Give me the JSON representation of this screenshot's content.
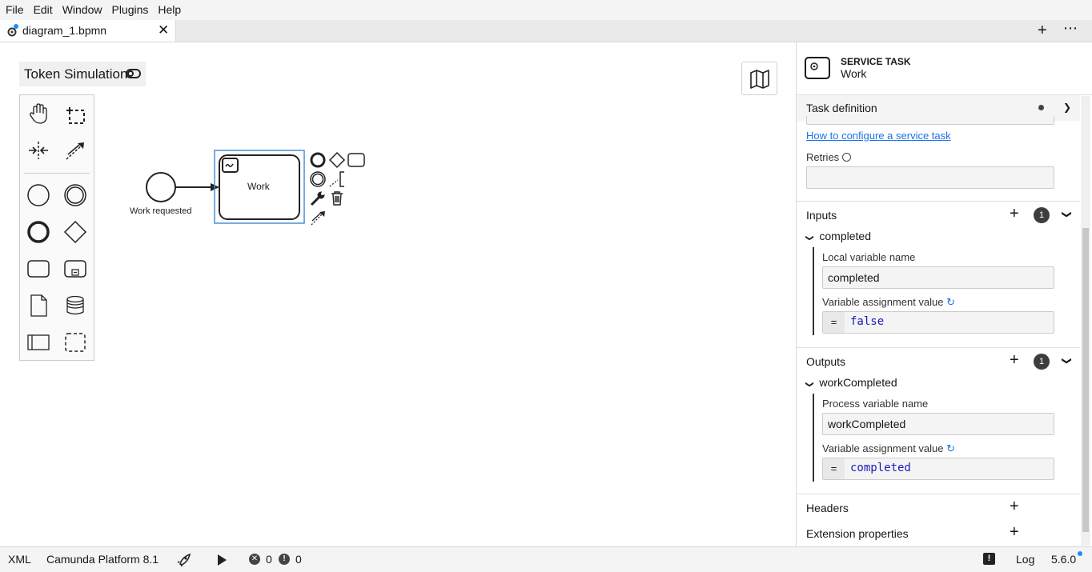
{
  "menu": [
    "File",
    "Edit",
    "Window",
    "Plugins",
    "Help"
  ],
  "tab": {
    "name": "diagram_1.bpmn",
    "close": "✕"
  },
  "tabbar": {
    "new_tab": "+",
    "more": "⋯"
  },
  "canvas": {
    "token_simulation": "Token Simulation",
    "start_event_label": "Work requested",
    "task_label": "Work"
  },
  "properties": {
    "element_type": "SERVICE TASK",
    "element_name": "Work",
    "task_definition": {
      "title": "Task definition",
      "link": "How to configure a service task",
      "retries_label": "Retries",
      "retries_value": ""
    },
    "inputs": {
      "title": "Inputs",
      "count": "1",
      "item_name": "completed",
      "local_var_label": "Local variable name",
      "local_var_value": "completed",
      "assign_label": "Variable assignment value",
      "assign_eq": "=",
      "assign_value": "false"
    },
    "outputs": {
      "title": "Outputs",
      "count": "1",
      "item_name": "workCompleted",
      "process_var_label": "Process variable name",
      "process_var_value": "workCompleted",
      "assign_label": "Variable assignment value",
      "assign_eq": "=",
      "assign_value": "completed"
    },
    "headers": {
      "title": "Headers"
    },
    "extension": {
      "title": "Extension properties"
    }
  },
  "status": {
    "xml": "XML",
    "platform": "Camunda Platform 8.1",
    "errors": "0",
    "warnings": "0",
    "log": "Log",
    "version": "5.6.0"
  },
  "colors": {
    "accent": "#1a8dff",
    "selection": "#4a90d9",
    "link": "#1a73e8"
  }
}
